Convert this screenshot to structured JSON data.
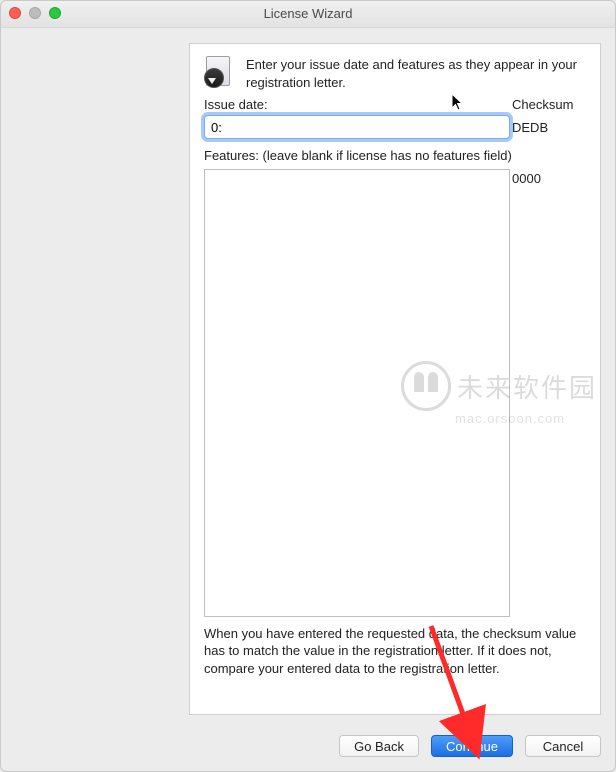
{
  "window": {
    "title": "License Wizard"
  },
  "intro": {
    "text": "Enter your issue date and features as they appear in your registration letter.",
    "icon": "document-inspect-icon"
  },
  "form": {
    "issue_date_label": "Issue date:",
    "issue_date_value": "0:",
    "checksum_label": "Checksum",
    "checksum_issue_date": "DEDB",
    "features_label": "Features: (leave blank if license has no features field)",
    "features_value": "",
    "checksum_features": "0000",
    "help_text": "When you have entered the requested data, the checksum value has to match the value in the registration letter.  If it does not, compare your entered data to the registration letter."
  },
  "buttons": {
    "go_back": "Go Back",
    "continue": "Continue",
    "cancel": "Cancel"
  },
  "watermark": {
    "line1": "未来软件园",
    "line2": "mac.orsoon.com"
  }
}
